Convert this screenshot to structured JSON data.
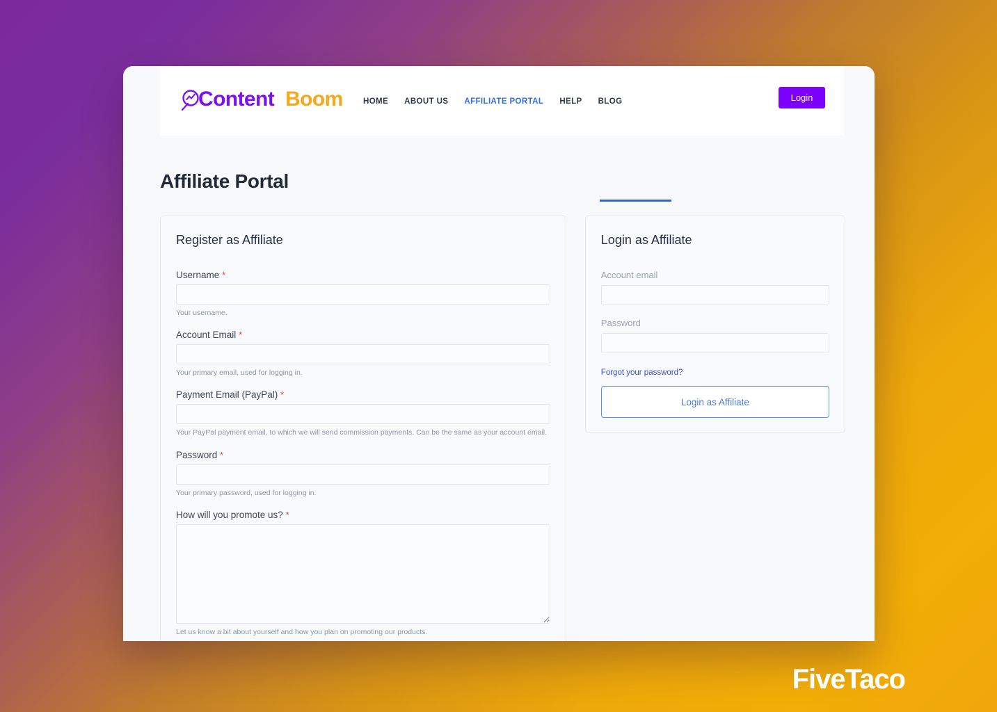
{
  "background": {
    "gradient_from": "#7b2a9e",
    "gradient_to": "#efa60c"
  },
  "watermark": {
    "text": "FiveTaco"
  },
  "header": {
    "logo": {
      "icon": "magnifier-chart-icon",
      "word_primary": "Content",
      "word_secondary": "Boom",
      "color_primary": "#7b10f0",
      "color_secondary": "#f5a81c"
    },
    "nav": [
      {
        "label": "HOME",
        "active": false
      },
      {
        "label": "ABOUT US",
        "active": false
      },
      {
        "label": "AFFILIATE PORTAL",
        "active": true
      },
      {
        "label": "HELP",
        "active": false
      },
      {
        "label": "BLOG",
        "active": false
      }
    ],
    "active_color": "#2f6fe4",
    "login_button": {
      "label": "Login",
      "color": "#7d00ff"
    }
  },
  "page": {
    "title": "Affiliate Portal"
  },
  "register_card": {
    "title": "Register as Affiliate",
    "fields": [
      {
        "label": "Username",
        "required_marker": "*",
        "value": "",
        "placeholder": "",
        "hint": "Your username.",
        "type": "text"
      },
      {
        "label": "Account Email",
        "required_marker": "*",
        "value": "",
        "placeholder": "",
        "hint": "Your primary email, used for logging in.",
        "type": "email"
      },
      {
        "label": "Payment Email (PayPal)",
        "required_marker": "*",
        "value": "",
        "placeholder": "",
        "hint": "Your PayPal payment email, to which we will send commission payments. Can be the same as your account email.",
        "type": "email"
      },
      {
        "label": "Password",
        "required_marker": "*",
        "value": "",
        "placeholder": "",
        "hint": "Your primary password, used for logging in.",
        "type": "password"
      },
      {
        "label": "How will you promote us?",
        "required_marker": "*",
        "value": "",
        "placeholder": "",
        "hint": "Let us know a bit about yourself and how you plan on promoting our products.",
        "type": "textarea"
      }
    ]
  },
  "login_card": {
    "title": "Login as Affiliate",
    "email_label": "Account email",
    "email_value": "",
    "email_placeholder": "",
    "password_label": "Password",
    "password_value": "",
    "password_placeholder": "",
    "forgot_link": "Forgot your password?",
    "submit_label": "Login as Affiliate",
    "link_color": "#3a4fd0",
    "button_border_color": "#5b92e8"
  }
}
